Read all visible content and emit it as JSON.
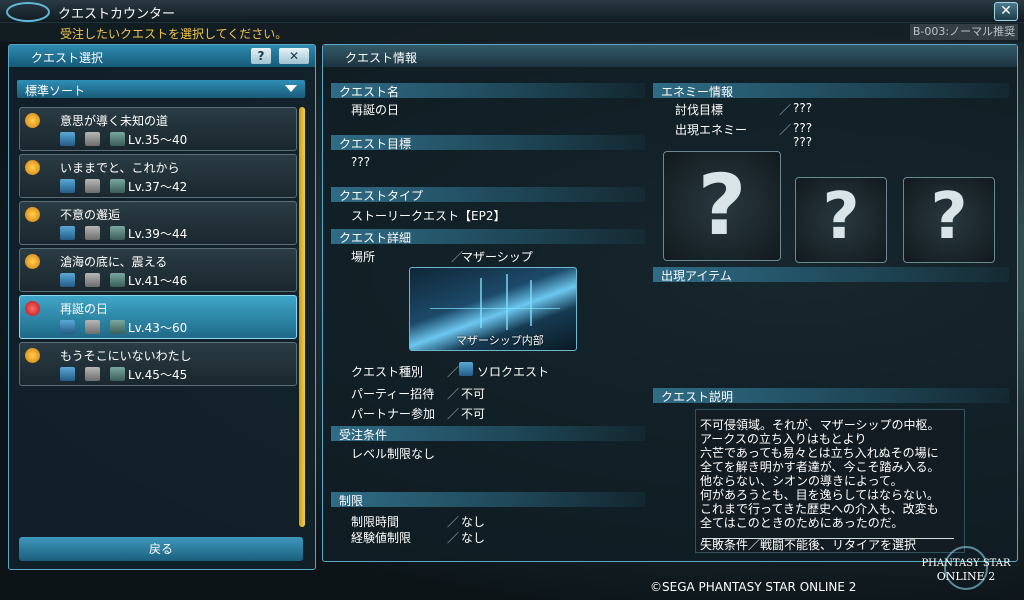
{
  "window": {
    "title": "クエストカウンター",
    "close": "✕"
  },
  "instruction": "受注したいクエストを選択してください。",
  "block": "B-003:ノーマル推奨",
  "left": {
    "title": "クエスト選択",
    "help": "?",
    "close": "✕",
    "sort": "標準ソート",
    "back": "戻る",
    "quests": [
      {
        "name": "意思が導く未知の道",
        "level": "Lv.35～40",
        "badge": "crown"
      },
      {
        "name": "いままでと、これから",
        "level": "Lv.37～42",
        "badge": "crown"
      },
      {
        "name": "不意の邂逅",
        "level": "Lv.39～44",
        "badge": "crown"
      },
      {
        "name": "滄海の底に、震える",
        "level": "Lv.41～46",
        "badge": "crown"
      },
      {
        "name": "再誕の日",
        "level": "Lv.43～60",
        "badge": "exclaim",
        "selected": true
      },
      {
        "name": "もうそこにいないわたし",
        "level": "Lv.45～45",
        "badge": "crown"
      }
    ]
  },
  "info": {
    "title": "クエスト情報",
    "name_label": "クエスト名",
    "name": "再誕の日",
    "goal_label": "クエスト目標",
    "goal": "???",
    "type_label": "クエストタイプ",
    "type": "ストーリークエスト【EP2】",
    "detail_label": "クエスト詳細",
    "place_label": "場所",
    "place": "マザーシップ",
    "map_caption": "マザーシップ内部",
    "kind_label": "クエスト種別",
    "kind": "ソロクエスト",
    "party_label": "パーティー招待",
    "party": "不可",
    "partner_label": "パートナー参加",
    "partner": "不可",
    "cond_label": "受注条件",
    "cond": "レベル制限なし",
    "limit_label": "制限",
    "time_label": "制限時間",
    "time": "なし",
    "exp_label": "経験値制限",
    "exp": "なし",
    "enemy_label": "エネミー情報",
    "target_label": "討伐目標",
    "target": "???",
    "appear_label": "出現エネミー",
    "appear1": "???",
    "appear2": "???",
    "qmark": "?",
    "item_label": "出現アイテム",
    "desc_label": "クエスト説明",
    "desc_lines": [
      "不可侵領域。それが、マザーシップの中枢。",
      "アークスの立ち入りはもとより",
      "六芒であっても易々とは立ち入れぬその場に",
      "全てを解き明かす者達が、今こそ踏み入る。",
      "他ならない、シオンの導きによって。",
      "何があろうとも、目を逸らしてはならない。",
      "これまで行ってきた歴史への介入も、改変も",
      "全てはこのときのためにあったのだ。"
    ],
    "fail": "失敗条件／戦闘不能後、リタイアを選択"
  },
  "slash": "／",
  "footer": "©SEGA PHANTASY STAR ONLINE 2",
  "logo": {
    "line1": "PHANTASY STAR",
    "line2": "ONLINE 2"
  },
  "colors": {
    "accent": "#2e8bb0",
    "gold": "#e6b63a"
  }
}
